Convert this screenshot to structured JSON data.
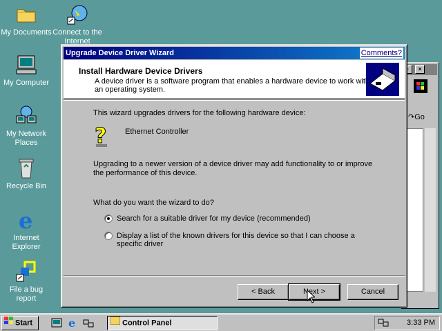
{
  "desktop": {
    "icons": [
      {
        "label": "My Documents"
      },
      {
        "label": "Connect to the Internet"
      },
      {
        "label": "My Computer"
      },
      {
        "label": "My Network Places"
      },
      {
        "label": "Recycle Bin"
      },
      {
        "label": "Internet Explorer"
      },
      {
        "label": "File a bug report"
      }
    ]
  },
  "bg_window": {
    "go_label": "Go"
  },
  "dialog": {
    "title": "Upgrade Device Driver Wizard",
    "comments_link": "Comments?",
    "header_title": "Install Hardware Device Drivers",
    "header_desc": "A device driver is a software program that enables a hardware device to work with an operating system.",
    "intro": "This wizard upgrades drivers for the following hardware device:",
    "device_name": "Ethernet Controller",
    "upgrade_text": "Upgrading to a newer version of a device driver may add functionality to or improve the performance of this device.",
    "question": "What do you want the wizard to do?",
    "options": [
      {
        "label": "Search for a suitable driver for my device (recommended)",
        "selected": true
      },
      {
        "label": "Display a list of the known drivers for this device so that I can choose a specific driver",
        "selected": false
      }
    ],
    "buttons": {
      "back": "< Back",
      "next": "Next >",
      "cancel": "Cancel"
    }
  },
  "taskbar": {
    "start_label": "Start",
    "task_label": "Control Panel",
    "clock": "3:33 PM"
  },
  "colors": {
    "desktop": "#5a9a9a",
    "title_start": "#000080",
    "title_end": "#1084d0",
    "face": "#c0c0c0"
  }
}
